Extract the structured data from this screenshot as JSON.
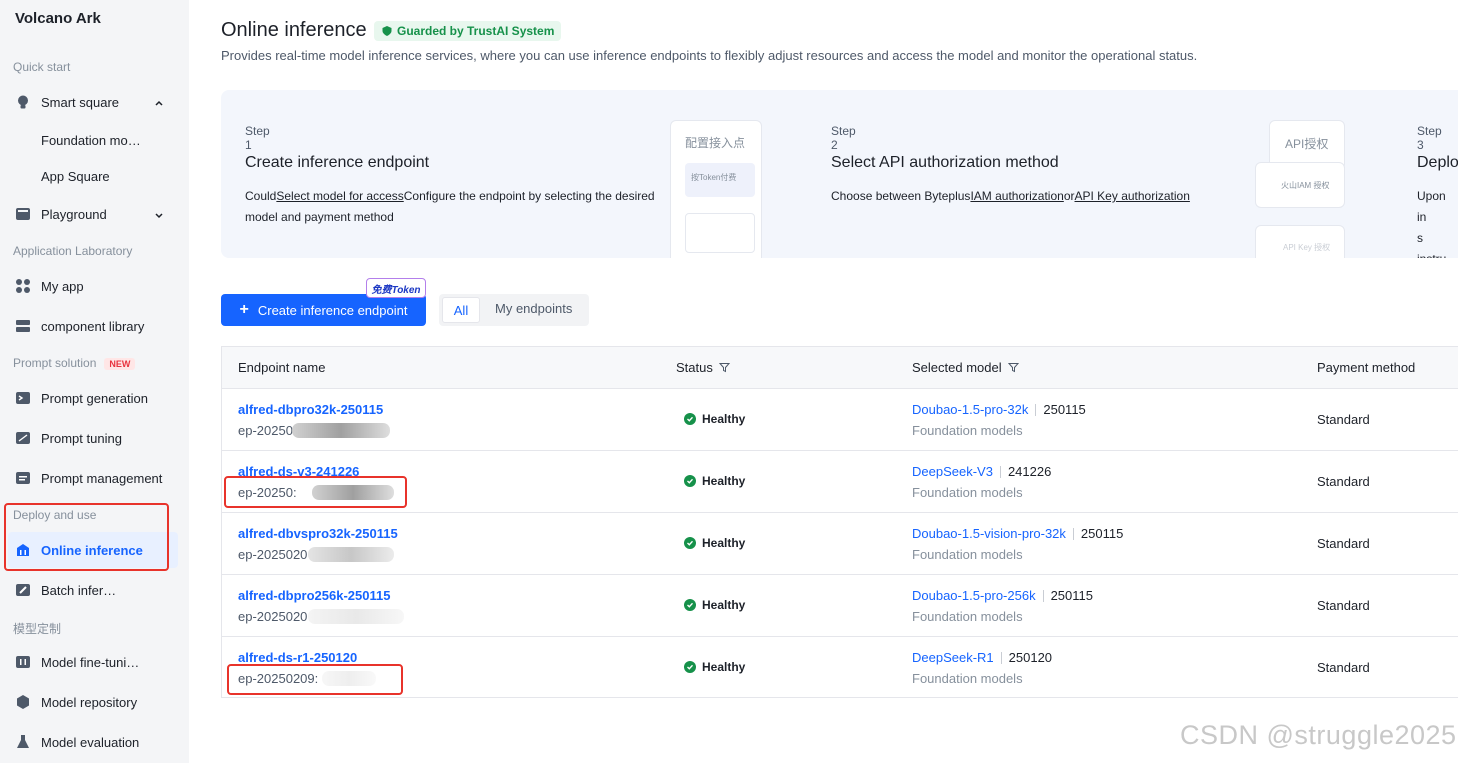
{
  "sidebar": {
    "brand": "Volcano Ark",
    "sections": {
      "quick_start": "Quick start",
      "app_lab": "Application Laboratory",
      "prompt_solution": "Prompt solution",
      "prompt_badge": "NEW",
      "deploy": "Deploy and use",
      "custom": "模型定制"
    },
    "items": {
      "smart_square": "Smart square",
      "foundation_models": "Foundation mo…",
      "app_square": "App Square",
      "playground": "Playground",
      "my_app": "My app",
      "component_library": "component library",
      "prompt_generation": "Prompt generation",
      "prompt_tuning": "Prompt tuning",
      "prompt_management": "Prompt management",
      "online_inference": "Online inference",
      "batch_inference": "Batch infer…",
      "fine_tuning": "Model fine-tuni…",
      "repository": "Model repository",
      "evaluation": "Model evaluation"
    }
  },
  "header": {
    "title": "Online inference",
    "badge": "Guarded by TrustAI System",
    "description": "Provides real-time model inference services, where you can use inference endpoints to flexibly adjust resources and access the model and monitor the operational status."
  },
  "steps": [
    {
      "num": "Step 1",
      "title": "Create inference endpoint",
      "desc_a": "Could",
      "desc_link": "Select model for access",
      "desc_b": "Configure the endpoint by selecting the desired",
      "desc_c": "model and payment method",
      "mock_title": "配置接入点",
      "mock_item": "按Token付费"
    },
    {
      "num": "Step 2",
      "title": "Select API authorization method",
      "desc_a": "Choose between Byteplus",
      "desc_link1": "IAM authorization",
      "desc_or": "or",
      "desc_link2": "API Key authorization",
      "mock_title": "API授权",
      "mock_item1": "火山IAM 授权",
      "mock_item2": "API Key 授权"
    },
    {
      "num": "Step 3",
      "title": "Deplo",
      "desc_a": "Upon in",
      "desc_b": "s instru"
    }
  ],
  "actions": {
    "create_label": "Create inference endpoint",
    "free_token": "免费Token",
    "filter_all": "All",
    "filter_mine": "My endpoints"
  },
  "table": {
    "columns": [
      "Endpoint name",
      "Status",
      "Selected model",
      "Payment method"
    ],
    "rows": [
      {
        "name": "alfred-dbpro32k-250115",
        "id": "ep-20250",
        "status": "Healthy",
        "model": "Doubao-1.5-pro-32k",
        "version": "250115",
        "family": "Foundation models",
        "payment": "Standard"
      },
      {
        "name": "alfred-ds-v3-241226",
        "id": "ep-20250:",
        "status": "Healthy",
        "model": "DeepSeek-V3",
        "version": "241226",
        "family": "Foundation models",
        "payment": "Standard"
      },
      {
        "name": "alfred-dbvspro32k-250115",
        "id": "ep-2025020",
        "status": "Healthy",
        "model": "Doubao-1.5-vision-pro-32k",
        "version": "250115",
        "family": "Foundation models",
        "payment": "Standard"
      },
      {
        "name": "alfred-dbpro256k-250115",
        "id": "ep-2025020",
        "status": "Healthy",
        "model": "Doubao-1.5-pro-256k",
        "version": "250115",
        "family": "Foundation models",
        "payment": "Standard"
      },
      {
        "name": "alfred-ds-r1-250120",
        "id": "ep-20250209:",
        "status": "Healthy",
        "model": "DeepSeek-R1",
        "version": "250120",
        "family": "Foundation models",
        "payment": "Standard"
      }
    ]
  },
  "watermark": "CSDN @struggle2025",
  "colors": {
    "accent": "#1664ff",
    "healthy": "#16914a",
    "highlight_box": "#e8332b",
    "sidebar_bg": "#f4f5f7"
  }
}
